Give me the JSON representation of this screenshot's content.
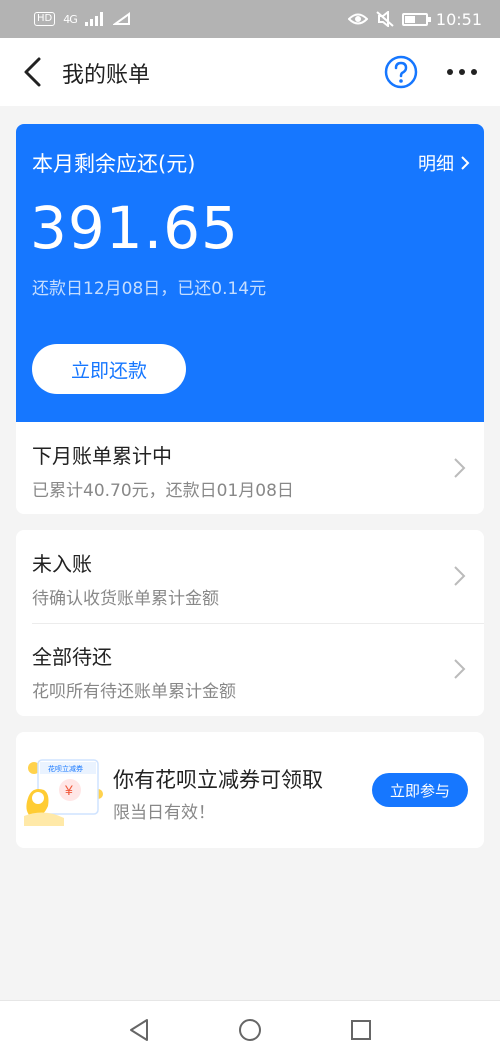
{
  "status_bar": {
    "hd_label": "HD",
    "signal_label": "4G",
    "time": "10:51",
    "battery_level": 0.45,
    "icons": [
      "eye-icon",
      "mute-icon",
      "battery-icon"
    ]
  },
  "header": {
    "title": "我的账单",
    "back_icon": "chevron-left-icon",
    "help_icon": "question-circle-icon",
    "more_icon": "more-dots-icon"
  },
  "bill": {
    "label": "本月剩余应还(元)",
    "detail_link": "明细",
    "amount": "391.65",
    "repay_info": "还款日12月08日，已还0.14元",
    "repay_button": "立即还款",
    "next_bill_title": "下月账单累计中",
    "next_bill_sub": "已累计40.70元，还款日01月08日"
  },
  "pending": [
    {
      "title": "未入账",
      "subtitle": "待确认收货账单累计金额"
    },
    {
      "title": "全部待还",
      "subtitle": "花呗所有待还账单累计金额"
    }
  ],
  "promo": {
    "coupon_label": "花呗立减券",
    "coupon_symbol": "¥",
    "title": "你有花呗立减券可领取",
    "subtitle": "限当日有效！",
    "button": "立即参与"
  },
  "colors": {
    "accent": "#1677ff",
    "background": "#f4f4f4",
    "status_bar": "#b3b3b3"
  },
  "system_nav": [
    "back-triangle-icon",
    "home-circle-icon",
    "recent-square-icon"
  ]
}
